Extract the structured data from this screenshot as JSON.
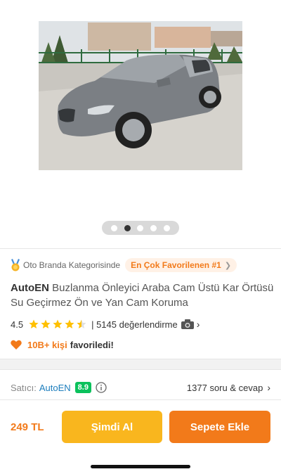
{
  "gallery": {
    "image_alt": "",
    "dot_count": 5,
    "active_index": 1
  },
  "category": {
    "icon": "medal-icon",
    "text": "Oto Branda Kategorisinde",
    "badge": "En Çok Favorilenen #1",
    "accent_color": "#f27a1a"
  },
  "product": {
    "brand": "AutoEN",
    "name": "Buzlanma Önleyici Araba Cam Üstü Kar Örtüsü Su Geçirmez Ön ve Yan Cam Koruma"
  },
  "rating": {
    "value": "4.5",
    "stars": 4.5,
    "review_count": "| 5145 değerlendirme",
    "icon": "camera-icon"
  },
  "favorites": {
    "count": "10B+ kişi",
    "text": "favoriledi!"
  },
  "seller": {
    "label": "Satıcı:",
    "name": "AutoEN",
    "score": "8.9",
    "score_color": "#0bc15c",
    "qa_link": "1377 soru & cevap"
  },
  "bottom_bar": {
    "price": "249 TL",
    "buy_now_label": "Şimdi Al",
    "add_to_cart_label": "Sepete Ekle",
    "buy_color": "#f9b61e",
    "cart_color": "#f27a1a"
  }
}
